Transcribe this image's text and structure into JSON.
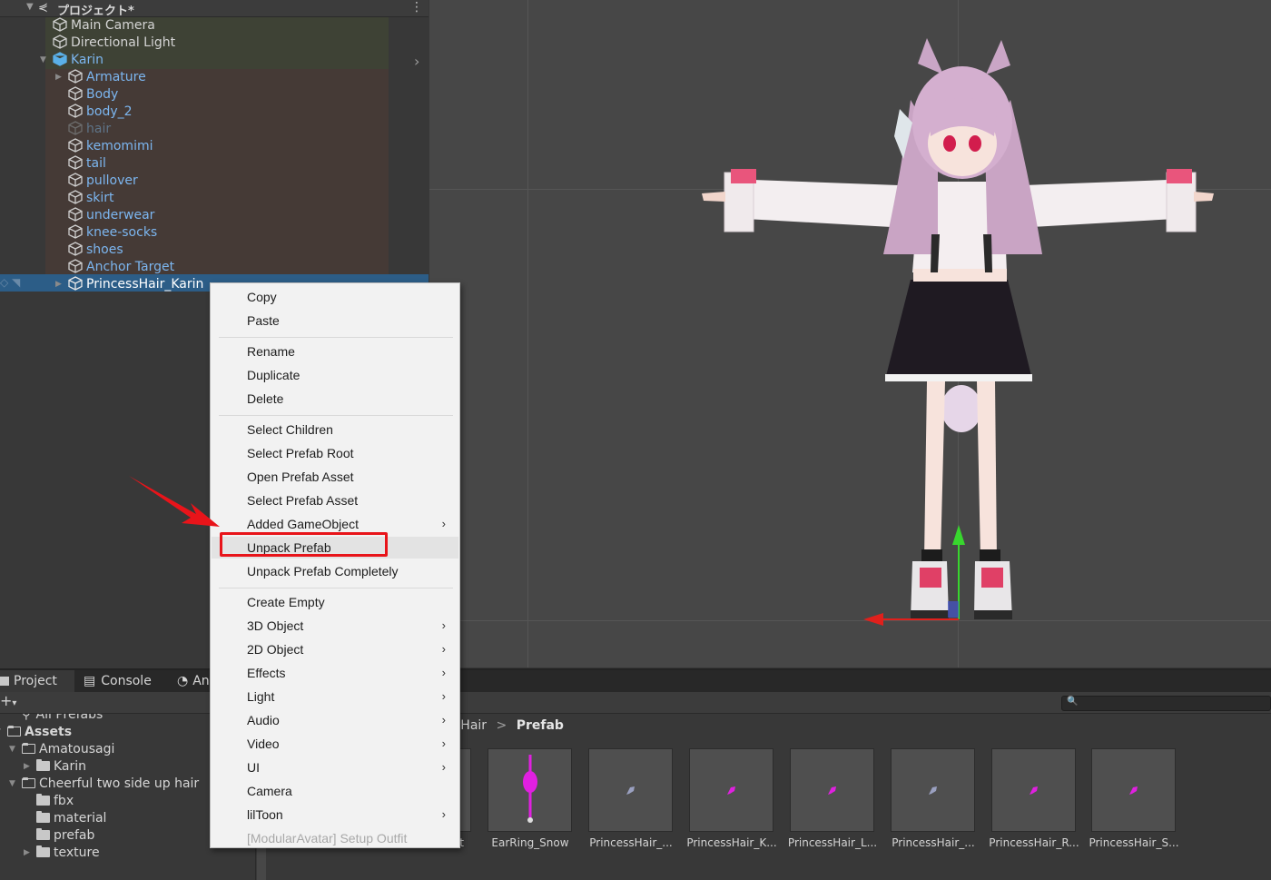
{
  "hierarchy": {
    "scene_title": "プロジェクト*",
    "items": [
      {
        "label": "Main Camera",
        "indent": 0,
        "color": "#d4d4d4",
        "cube": "#cfcfcf",
        "expand": ""
      },
      {
        "label": "Directional Light",
        "indent": 0,
        "color": "#d4d4d4",
        "cube": "#cfcfcf",
        "expand": ""
      },
      {
        "label": "Karin",
        "indent": 0,
        "color": "#7cb6f0",
        "cube": "#5ab0e8",
        "expand": "▼"
      },
      {
        "label": "Armature",
        "indent": 1,
        "color": "#7cb6f0",
        "cube": "#cfcfcf",
        "expand": "▶"
      },
      {
        "label": "Body",
        "indent": 1,
        "color": "#7cb6f0",
        "cube": "#cfcfcf",
        "expand": ""
      },
      {
        "label": "body_2",
        "indent": 1,
        "color": "#7cb6f0",
        "cube": "#cfcfcf",
        "expand": ""
      },
      {
        "label": "hair",
        "indent": 1,
        "color": "#5e7488",
        "cube": "#6c6c6c",
        "expand": ""
      },
      {
        "label": "kemomimi",
        "indent": 1,
        "color": "#7cb6f0",
        "cube": "#cfcfcf",
        "expand": ""
      },
      {
        "label": "tail",
        "indent": 1,
        "color": "#7cb6f0",
        "cube": "#cfcfcf",
        "expand": ""
      },
      {
        "label": "pullover",
        "indent": 1,
        "color": "#7cb6f0",
        "cube": "#cfcfcf",
        "expand": ""
      },
      {
        "label": "skirt",
        "indent": 1,
        "color": "#7cb6f0",
        "cube": "#cfcfcf",
        "expand": ""
      },
      {
        "label": "underwear",
        "indent": 1,
        "color": "#7cb6f0",
        "cube": "#cfcfcf",
        "expand": ""
      },
      {
        "label": "knee-socks",
        "indent": 1,
        "color": "#7cb6f0",
        "cube": "#cfcfcf",
        "expand": ""
      },
      {
        "label": "shoes",
        "indent": 1,
        "color": "#7cb6f0",
        "cube": "#cfcfcf",
        "expand": ""
      },
      {
        "label": "Anchor Target",
        "indent": 1,
        "color": "#7cb6f0",
        "cube": "#cfcfcf",
        "expand": ""
      },
      {
        "label": "PrincessHair_Karin",
        "indent": 1,
        "color": "#ffffff",
        "cube": "#e8e8e8",
        "expand": "▶"
      }
    ]
  },
  "bottom": {
    "tabs": [
      {
        "label": "Project",
        "icon": "folder-icon"
      },
      {
        "label": "Console",
        "icon": "console-icon"
      },
      {
        "label": "An",
        "icon": "clock-icon"
      }
    ],
    "search_placeholder": "",
    "tree": [
      {
        "label": "All Prefabs",
        "indent": 1,
        "kind": "search",
        "expand": ""
      },
      {
        "label": "Assets",
        "indent": 0,
        "kind": "folder-open",
        "expand": "▼",
        "bold": true
      },
      {
        "label": "Amatousagi",
        "indent": 1,
        "kind": "folder-open",
        "expand": "▼"
      },
      {
        "label": "Karin",
        "indent": 2,
        "kind": "folder",
        "expand": "▶"
      },
      {
        "label": "Cheerful two side up hair",
        "indent": 1,
        "kind": "folder-open",
        "expand": "▼"
      },
      {
        "label": "fbx",
        "indent": 2,
        "kind": "folder",
        "expand": ""
      },
      {
        "label": "material",
        "indent": 2,
        "kind": "folder",
        "expand": ""
      },
      {
        "label": "prefab",
        "indent": 2,
        "kind": "folder",
        "expand": ""
      },
      {
        "label": "texture",
        "indent": 2,
        "kind": "folder",
        "expand": "▶"
      }
    ],
    "breadcrumb": {
      "parent": "sHair",
      "sep": ">",
      "current": "Prefab"
    },
    "assets": [
      {
        "label": "t",
        "tint": "#8a8a8a"
      },
      {
        "label": "EarRing_Snow",
        "tint": "#e020e0"
      },
      {
        "label": "PrincessHair_...",
        "tint": "#9aa0c0"
      },
      {
        "label": "PrincessHair_K...",
        "tint": "#e020e0"
      },
      {
        "label": "PrincessHair_L...",
        "tint": "#e020e0"
      },
      {
        "label": "PrincessHair_...",
        "tint": "#9aa0c0"
      },
      {
        "label": "PrincessHair_R...",
        "tint": "#e020e0"
      },
      {
        "label": "PrincessHair_S...",
        "tint": "#e020e0"
      }
    ]
  },
  "context_menu": {
    "items": [
      {
        "label": "Copy",
        "submenu": false,
        "disabled": false
      },
      {
        "label": "Paste",
        "submenu": false,
        "disabled": false
      },
      {
        "sep": true
      },
      {
        "label": "Rename",
        "submenu": false,
        "disabled": false
      },
      {
        "label": "Duplicate",
        "submenu": false,
        "disabled": false
      },
      {
        "label": "Delete",
        "submenu": false,
        "disabled": false
      },
      {
        "sep": true
      },
      {
        "label": "Select Children",
        "submenu": false,
        "disabled": false
      },
      {
        "label": "Select Prefab Root",
        "submenu": false,
        "disabled": false
      },
      {
        "label": "Open Prefab Asset",
        "submenu": false,
        "disabled": false
      },
      {
        "label": "Select Prefab Asset",
        "submenu": false,
        "disabled": false
      },
      {
        "label": "Added GameObject",
        "submenu": true,
        "disabled": false
      },
      {
        "label": "Unpack Prefab",
        "submenu": false,
        "disabled": false,
        "hovered": true
      },
      {
        "label": "Unpack Prefab Completely",
        "submenu": false,
        "disabled": false
      },
      {
        "sep": true
      },
      {
        "label": "Create Empty",
        "submenu": false,
        "disabled": false
      },
      {
        "label": "3D Object",
        "submenu": true,
        "disabled": false
      },
      {
        "label": "2D Object",
        "submenu": true,
        "disabled": false
      },
      {
        "label": "Effects",
        "submenu": true,
        "disabled": false
      },
      {
        "label": "Light",
        "submenu": true,
        "disabled": false
      },
      {
        "label": "Audio",
        "submenu": true,
        "disabled": false
      },
      {
        "label": "Video",
        "submenu": true,
        "disabled": false
      },
      {
        "label": "UI",
        "submenu": true,
        "disabled": false
      },
      {
        "label": "Camera",
        "submenu": false,
        "disabled": false
      },
      {
        "label": "lilToon",
        "submenu": true,
        "disabled": false
      },
      {
        "label": "[ModularAvatar] Setup Outfit",
        "submenu": false,
        "disabled": true
      }
    ]
  },
  "colors": {
    "selection": "#2c5d87",
    "prefab_blue": "#7cb6f0",
    "annotation_red": "#e8141a",
    "menu_bg": "#f2f2f2"
  }
}
